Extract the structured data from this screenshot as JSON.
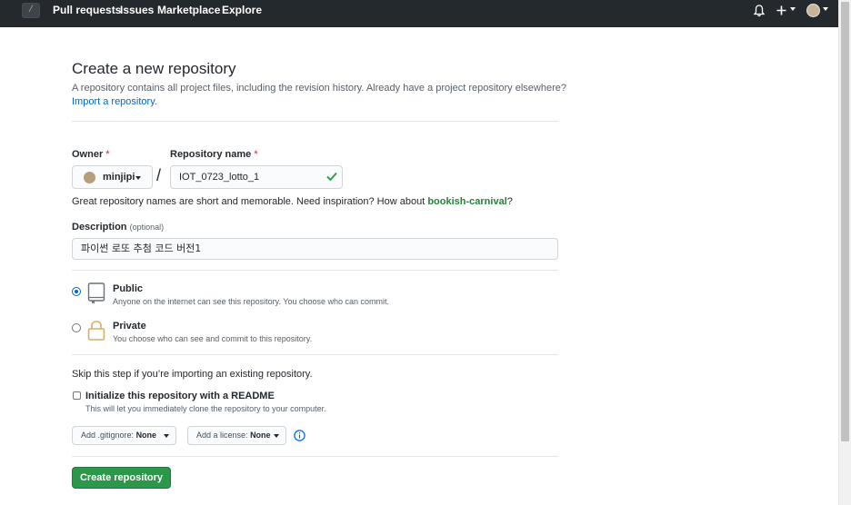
{
  "header": {
    "slash_glyph": "/",
    "nav": [
      "Pull requests",
      "Issues",
      "Marketplace",
      "Explore"
    ],
    "icons": [
      "bell-icon",
      "plus-icon",
      "avatar"
    ]
  },
  "page": {
    "title": "Create a new repository",
    "subtitle": "A repository contains all project files, including the revision history. Already have a project repository elsewhere?",
    "import_link": "Import a repository."
  },
  "form": {
    "owner_label": "Owner",
    "owner_value": "minjipi",
    "repo_label": "Repository name",
    "required_mark": "*",
    "separator": "/",
    "repo_value": "IOT_0723_lotto_1",
    "hint_prefix": "Great repository names are short and memorable. Need inspiration? How about",
    "hint_suggestion": "bookish-carnival",
    "hint_suffix": "?",
    "description_label": "Description",
    "description_optional": "(optional)",
    "description_value": "파이썬 로또 추첨 코드 버전1"
  },
  "visibility": {
    "selected": "public",
    "public_title": "Public",
    "public_desc": "Anyone on the internet can see this repository. You choose who can commit.",
    "private_title": "Private",
    "private_desc": "You choose who can see and commit to this repository."
  },
  "init": {
    "skip_text": "Skip this step if you’re importing an existing repository.",
    "readme_title": "Initialize this repository with a README",
    "readme_desc": "This will let you immediately clone the repository to your computer.",
    "readme_checked": false,
    "gitignore_label": "Add .gitignore:",
    "gitignore_value": "None",
    "license_label": "Add a license:",
    "license_value": "None"
  },
  "actions": {
    "create_label": "Create repository"
  },
  "colors": {
    "header_bg": "#24292e",
    "link": "#0366d6",
    "success": "#2c974b",
    "required": "#cb2431",
    "suggestion": "#22863a"
  }
}
